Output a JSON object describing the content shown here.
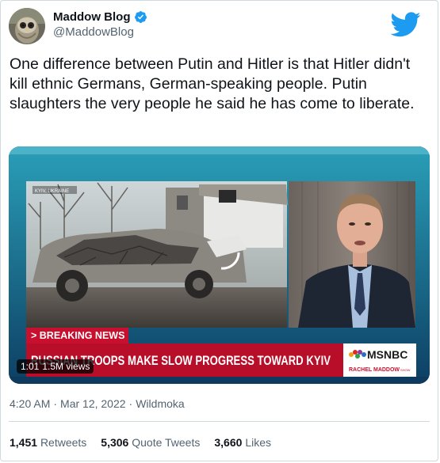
{
  "author": {
    "name": "Maddow Blog",
    "handle": "@MaddowBlog",
    "verified_icon": "verified-badge-icon",
    "avatar_icon": "owl-avatar"
  },
  "brand_icon": "twitter-bird-icon",
  "tweet": {
    "text": "One difference between Putin and Hitler is that Hitler didn't kill ethnic Germans, German-speaking people. Putin slaughters the very people he said he has come to liberate."
  },
  "media": {
    "location_label": "KYIV, UKRAINE",
    "breaking_label": "> BREAKING NEWS",
    "headline": "RUSSIAN TROOPS MAKE SLOW PROGRESS TOWARD KYIV",
    "network": "MSNBC",
    "show": "RACHEL MADDOW",
    "show_suffix": "SHOW",
    "duration": "1:01",
    "views": "1.5M views"
  },
  "meta": {
    "time": "4:20 AM",
    "sep1": "·",
    "date": "Mar 12, 2022",
    "sep2": "·",
    "source": "Wildmoka"
  },
  "stats": {
    "retweets_count": "1,451",
    "retweets_label": "Retweets",
    "quote_count": "5,306",
    "quote_label": "Quote Tweets",
    "likes_count": "3,660",
    "likes_label": "Likes"
  },
  "colors": {
    "twitter_blue": "#1d9bf0",
    "banner_red": "#c8102e",
    "border": "#cfd9de",
    "muted": "#536471"
  }
}
